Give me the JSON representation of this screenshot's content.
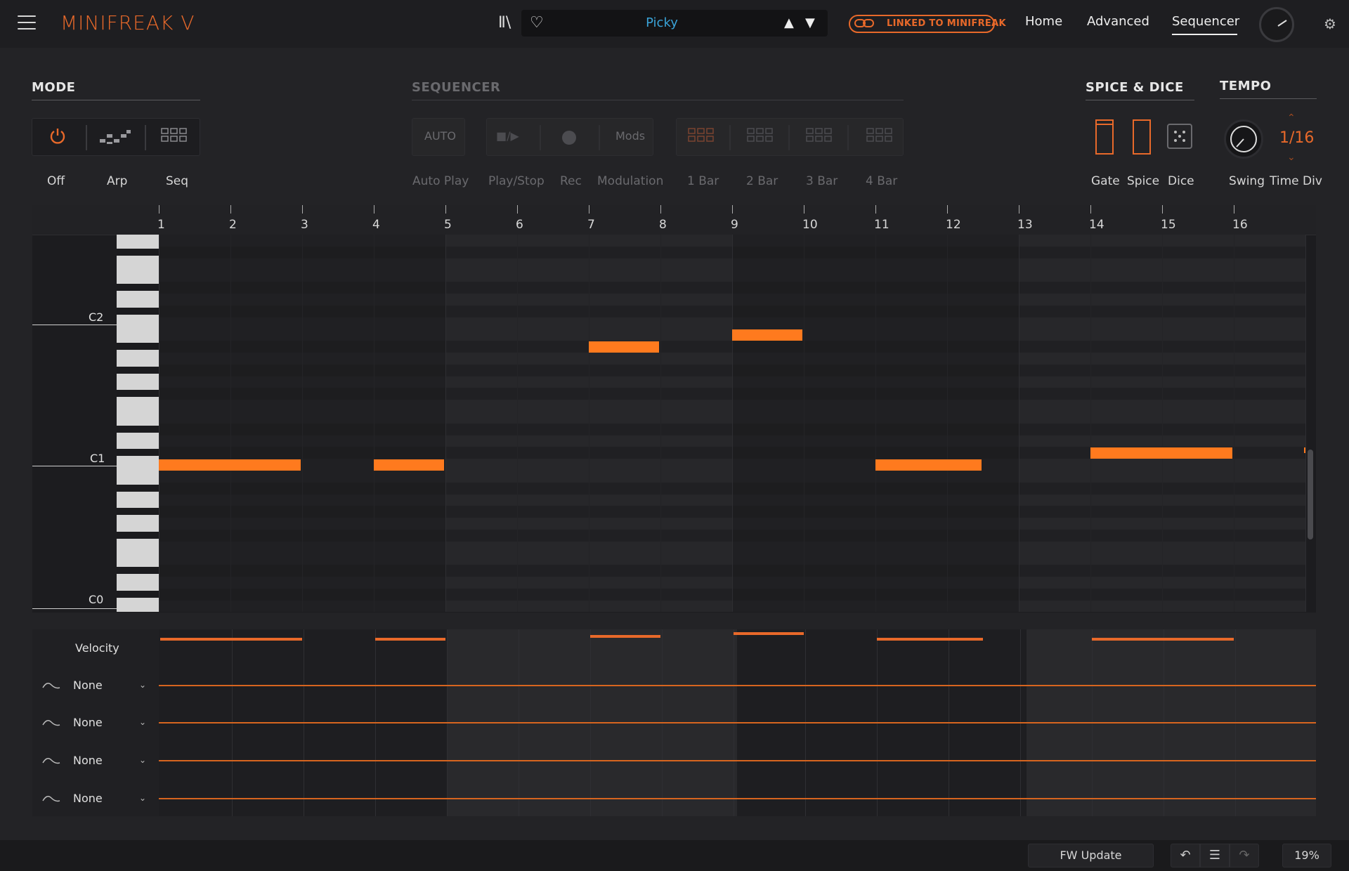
{
  "app": {
    "title": "MINIFREAK V"
  },
  "preset": {
    "name": "Picky"
  },
  "link": {
    "label": "LINKED TO MINIFREAK"
  },
  "nav": {
    "home": "Home",
    "advanced": "Advanced",
    "sequencer": "Sequencer",
    "active": "Sequencer"
  },
  "mode": {
    "title": "MODE",
    "labels": [
      "Off",
      "Arp",
      "Seq"
    ]
  },
  "sequencer": {
    "title": "SEQUENCER",
    "auto_label": "AUTO",
    "mods_label": "Mods",
    "labels": [
      "Auto Play",
      "Play/Stop",
      "Rec",
      "Modulation",
      "1 Bar",
      "2 Bar",
      "3 Bar",
      "4 Bar"
    ]
  },
  "spice_dice": {
    "title": "SPICE & DICE",
    "labels": [
      "Gate",
      "Spice",
      "Dice"
    ]
  },
  "tempo": {
    "title": "TEMPO",
    "labels": [
      "Swing",
      "Time Div"
    ],
    "time_div": "1/16"
  },
  "roll": {
    "bars": [
      "1",
      "2",
      "3",
      "4",
      "5",
      "6",
      "7",
      "8",
      "9",
      "10",
      "11",
      "12",
      "13",
      "14",
      "15",
      "16"
    ],
    "octaves": [
      "C2",
      "C1",
      "C0"
    ],
    "notes": [
      {
        "step": 1,
        "length": 2,
        "note": "C1"
      },
      {
        "step": 4,
        "length": 1,
        "note": "C1"
      },
      {
        "step": 7,
        "length": 1,
        "note": "A#1"
      },
      {
        "step": 9,
        "length": 1,
        "note": "B1"
      },
      {
        "step": 11,
        "length": 1.5,
        "note": "C1"
      },
      {
        "step": 14,
        "length": 2,
        "note": "C#1"
      }
    ]
  },
  "lanes": {
    "velocity_label": "Velocity",
    "mods": [
      {
        "label": "None"
      },
      {
        "label": "None"
      },
      {
        "label": "None"
      },
      {
        "label": "None"
      }
    ]
  },
  "status": {
    "fw_update": "FW Update",
    "cpu": "19%"
  },
  "colors": {
    "accent": "#e8692a",
    "note": "#ff7a1e",
    "preset_text": "#3aa3d8"
  }
}
